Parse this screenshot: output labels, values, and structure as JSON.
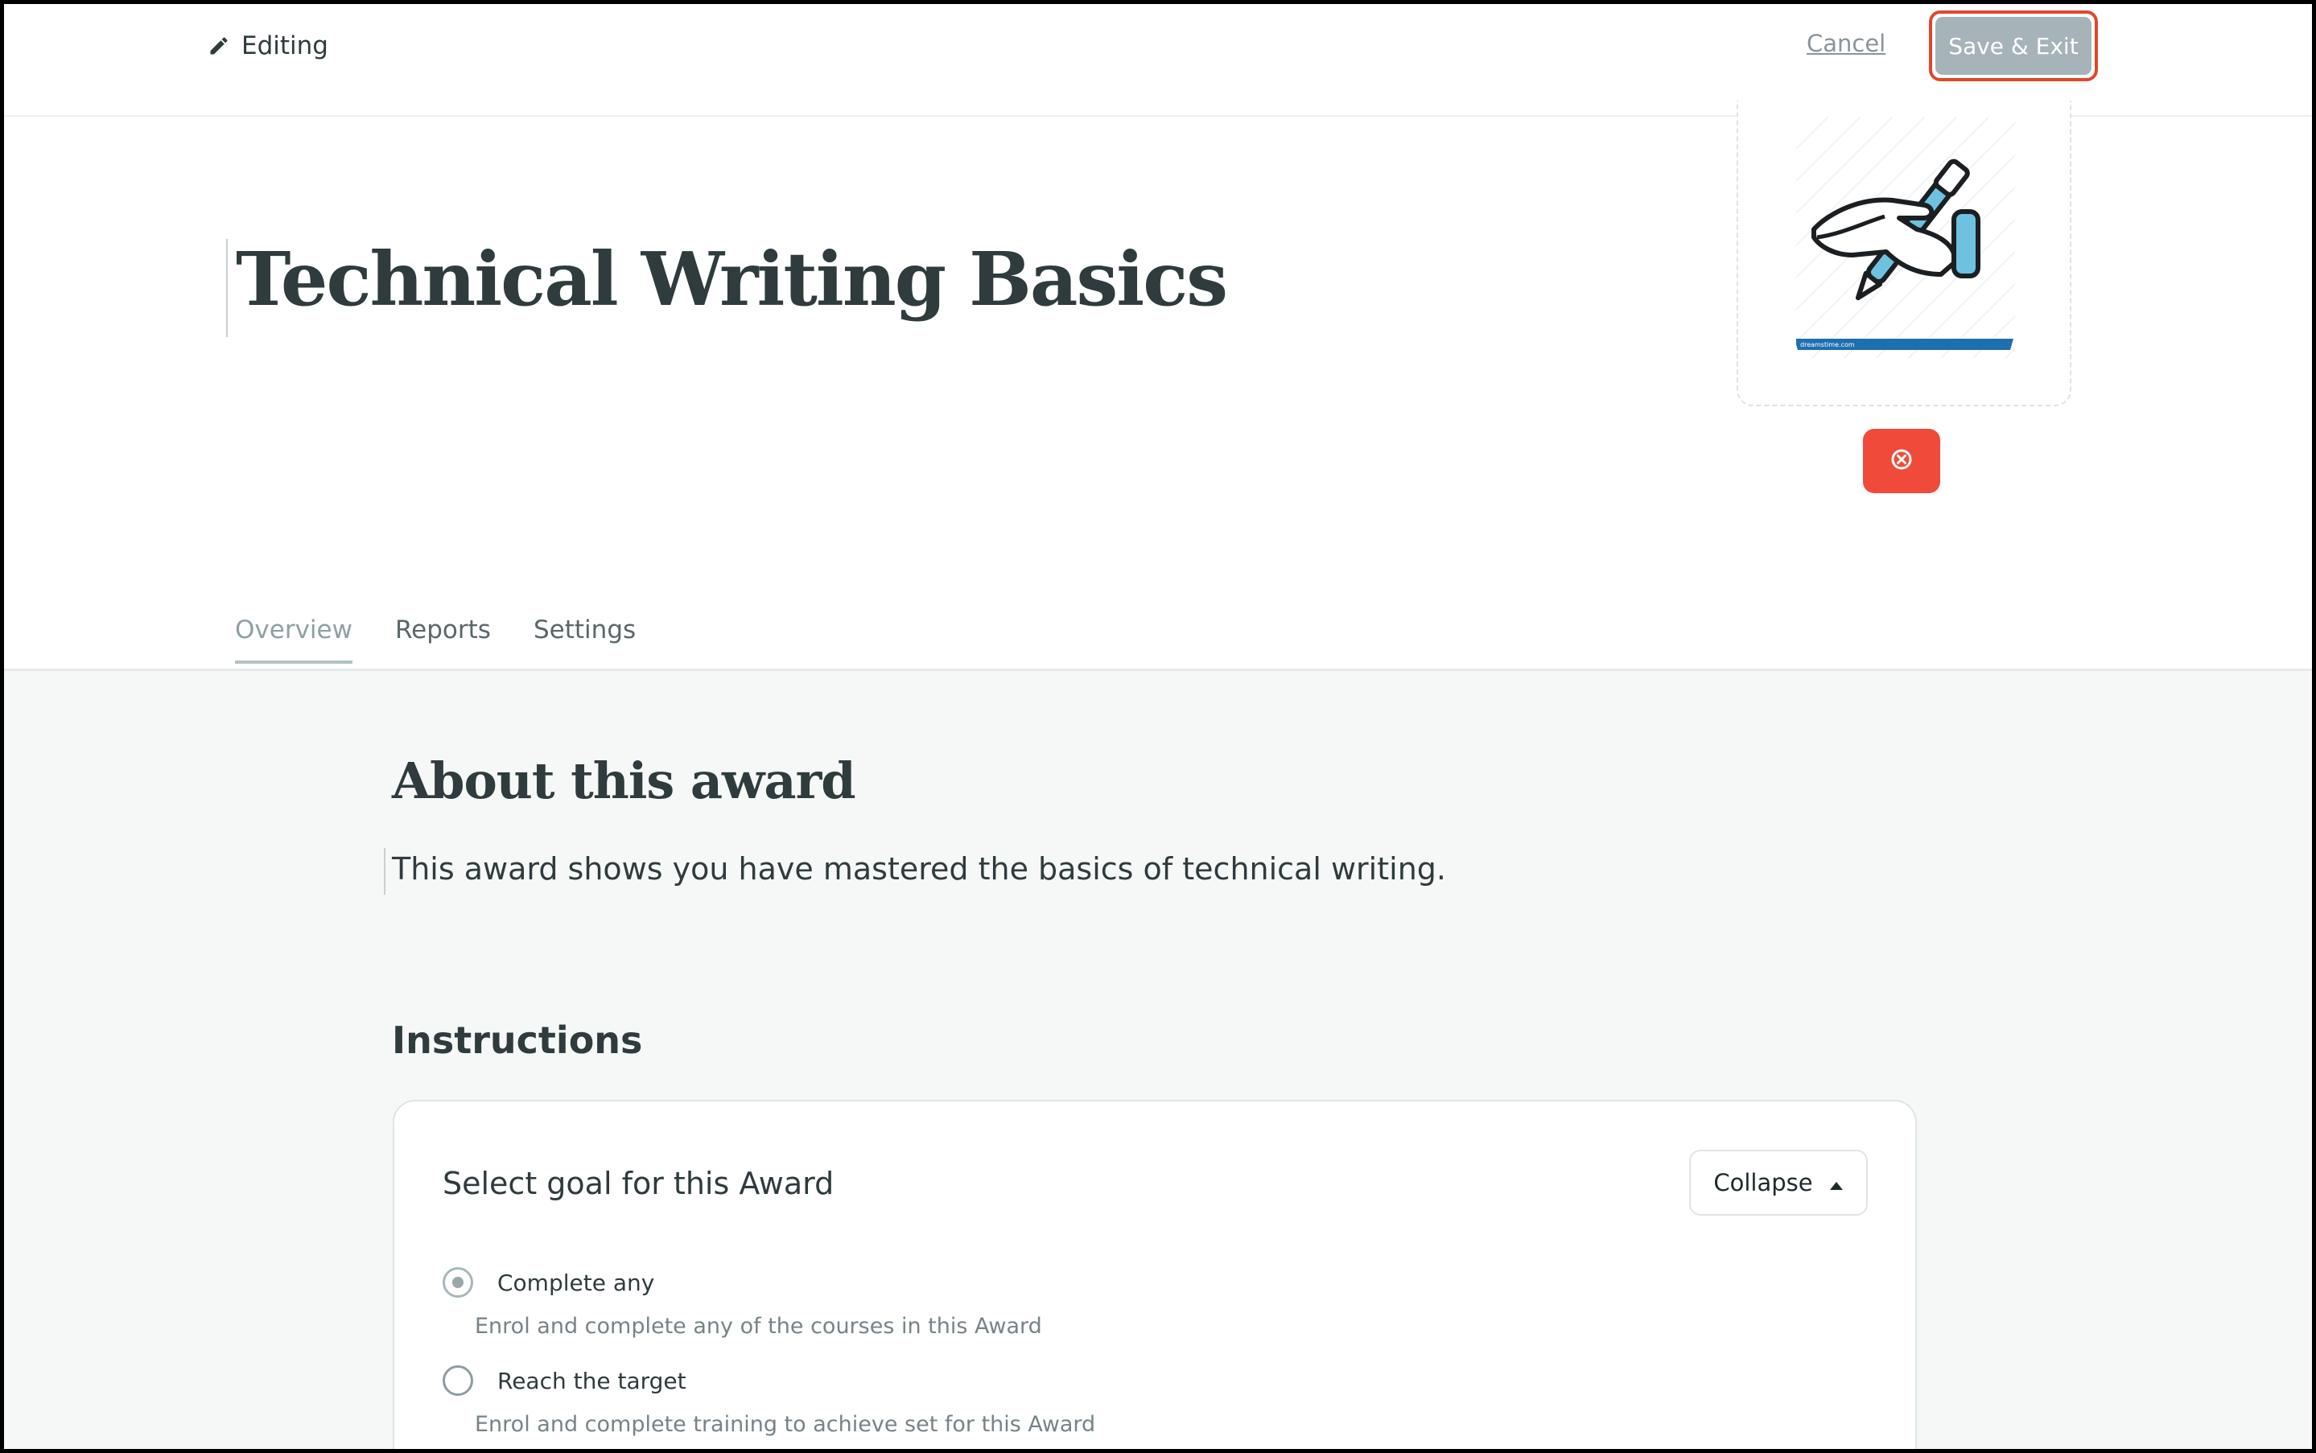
{
  "topbar": {
    "editing_label": "Editing",
    "cancel_label": "Cancel",
    "save_label": "Save & Exit"
  },
  "header": {
    "title": "Technical Writing Basics",
    "badge_caption": "dreamstime.com"
  },
  "tabs": [
    {
      "label": "Overview",
      "active": true
    },
    {
      "label": "Reports",
      "active": false
    },
    {
      "label": "Settings",
      "active": false
    }
  ],
  "about": {
    "heading": "About this award",
    "description": "This award shows you have mastered the basics of technical writing."
  },
  "instructions": {
    "heading": "Instructions",
    "card_title": "Select goal for this Award",
    "collapse_label": "Collapse",
    "options": [
      {
        "label": "Complete any",
        "description": "Enrol and complete any of the courses in this Award",
        "selected": true
      },
      {
        "label": "Reach the target",
        "description": "Enrol and complete training to achieve set for this Award",
        "selected": false
      }
    ]
  },
  "colors": {
    "save_border": "#e0472c",
    "save_fill": "#a6b3b8",
    "remove_button": "#f04a3a",
    "content_background": "#f6f7f7"
  },
  "icons": {
    "editing": "pencil-icon",
    "remove": "close-circle-icon",
    "collapse": "caret-up-icon",
    "badge": "hand-writing-pen-illustration"
  }
}
